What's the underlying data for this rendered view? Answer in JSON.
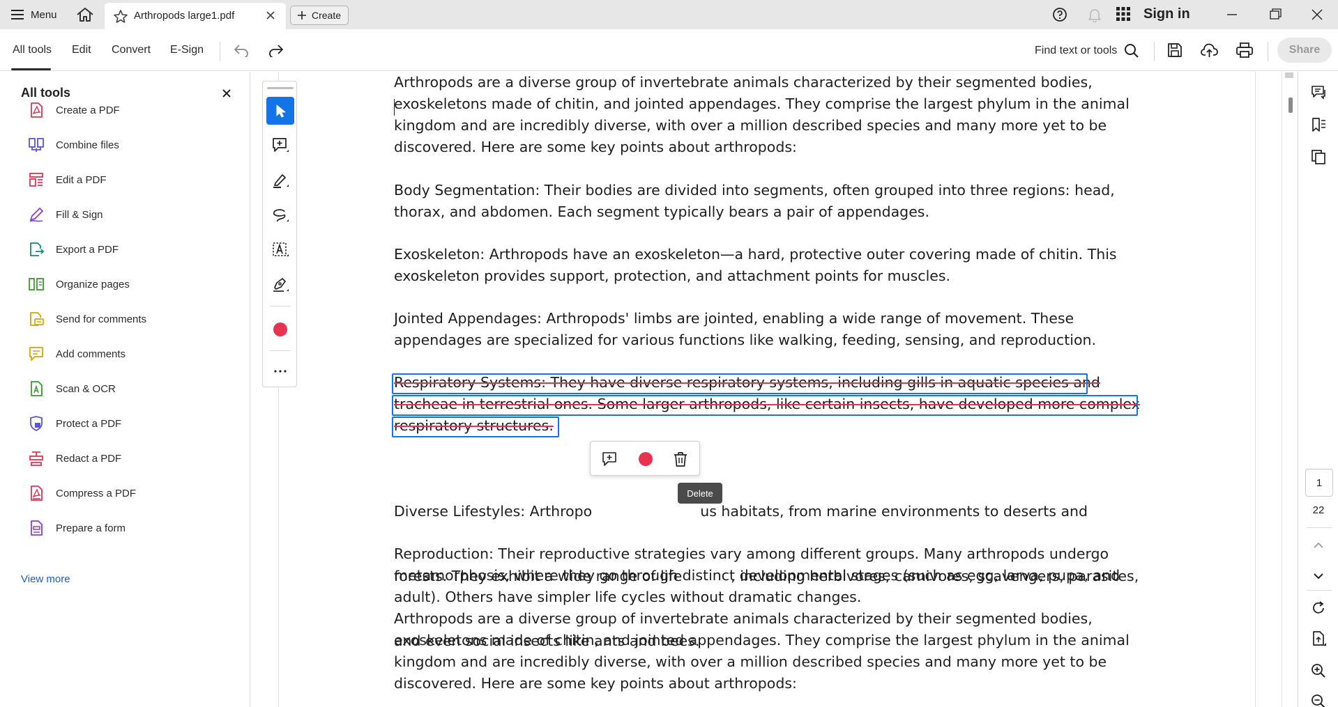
{
  "titlebar": {
    "menu_label": "Menu",
    "tab_title": "Arthropods large1.pdf",
    "create_label": "Create",
    "signin_label": "Sign in"
  },
  "toolbar": {
    "tabs": [
      "All tools",
      "Edit",
      "Convert",
      "E-Sign"
    ],
    "find_label": "Find text or tools",
    "share_label": "Share"
  },
  "left_panel": {
    "title": "All tools",
    "items": [
      {
        "label": "Create a PDF",
        "icon": "create-pdf-icon"
      },
      {
        "label": "Combine files",
        "icon": "combine-files-icon"
      },
      {
        "label": "Edit a PDF",
        "icon": "edit-pdf-icon"
      },
      {
        "label": "Fill & Sign",
        "icon": "fill-sign-icon"
      },
      {
        "label": "Export a PDF",
        "icon": "export-pdf-icon"
      },
      {
        "label": "Organize pages",
        "icon": "organize-pages-icon"
      },
      {
        "label": "Send for comments",
        "icon": "send-comments-icon"
      },
      {
        "label": "Add comments",
        "icon": "add-comments-icon"
      },
      {
        "label": "Scan & OCR",
        "icon": "scan-ocr-icon"
      },
      {
        "label": "Protect a PDF",
        "icon": "protect-pdf-icon"
      },
      {
        "label": "Redact a PDF",
        "icon": "redact-pdf-icon"
      },
      {
        "label": "Compress a PDF",
        "icon": "compress-pdf-icon"
      },
      {
        "label": "Prepare a form",
        "icon": "prepare-form-icon"
      }
    ],
    "view_more": "View more"
  },
  "document": {
    "paragraphs": [
      [
        "Arthropods are a diverse group of invertebrate animals characterized by their segmented bodies,",
        "exoskeletons made of chitin, and jointed appendages. They comprise the largest phylum in the animal",
        "kingdom and are incredibly diverse, with over a million described species and many more yet to be",
        "discovered. Here are some key points about arthropods:"
      ],
      [
        "Body Segmentation: Their bodies are divided into segments, often grouped into three regions: head,",
        "thorax, and abdomen. Each segment typically bears a pair of appendages."
      ],
      [
        "Exoskeleton: Arthropods have an exoskeleton—a hard, protective outer covering made of chitin. This",
        "exoskeleton provides support, protection, and attachment points for muscles."
      ],
      [
        "Jointed Appendages: Arthropods' limbs are jointed, enabling a wide range of movement. These",
        "appendages are specialized for various functions like walking, feeding, sensing, and reproduction."
      ],
      [
        "Respiratory Systems: They have diverse respiratory systems, including gills in aquatic species and",
        "tracheae in terrestrial ones. Some larger arthropods, like certain insects, have developed more complex",
        "respiratory structures."
      ],
      [
        "Diverse Lifestyles: Arthropo",
        "forests. They exhibit a wide range of life",
        "and even social insects like ants and bees."
      ],
      [
        "Reproduction: Their reproductive strategies vary among different groups. Many arthropods undergo",
        "metamorphosis, where they go through distinct developmental stages (such as egg, larva, pupa, and",
        "adult). Others have simpler life cycles without dramatic changes.",
        "Arthropods are a diverse group of invertebrate animals characterized by their segmented bodies,",
        "exoskeletons made of chitin, and jointed appendages. They comprise the largest phylum in the animal",
        "kingdom and are incredibly diverse, with over a million described species and many more yet to be",
        "discovered. Here are some key points about arthropods:"
      ]
    ],
    "lifestyles_tail_1": "us habitats, from marine environments to deserts and",
    "lifestyles_tail_2": ", including herbivores, carnivores, scavengers, parasites,"
  },
  "annotation_popup": {
    "tooltip": "Delete",
    "color": "#e8334f"
  },
  "page_nav": {
    "current_page": "1",
    "total_pages": "22"
  },
  "colors": {
    "accent": "#1473e6",
    "strike": "#e0344f",
    "link": "#1b5fc1"
  }
}
